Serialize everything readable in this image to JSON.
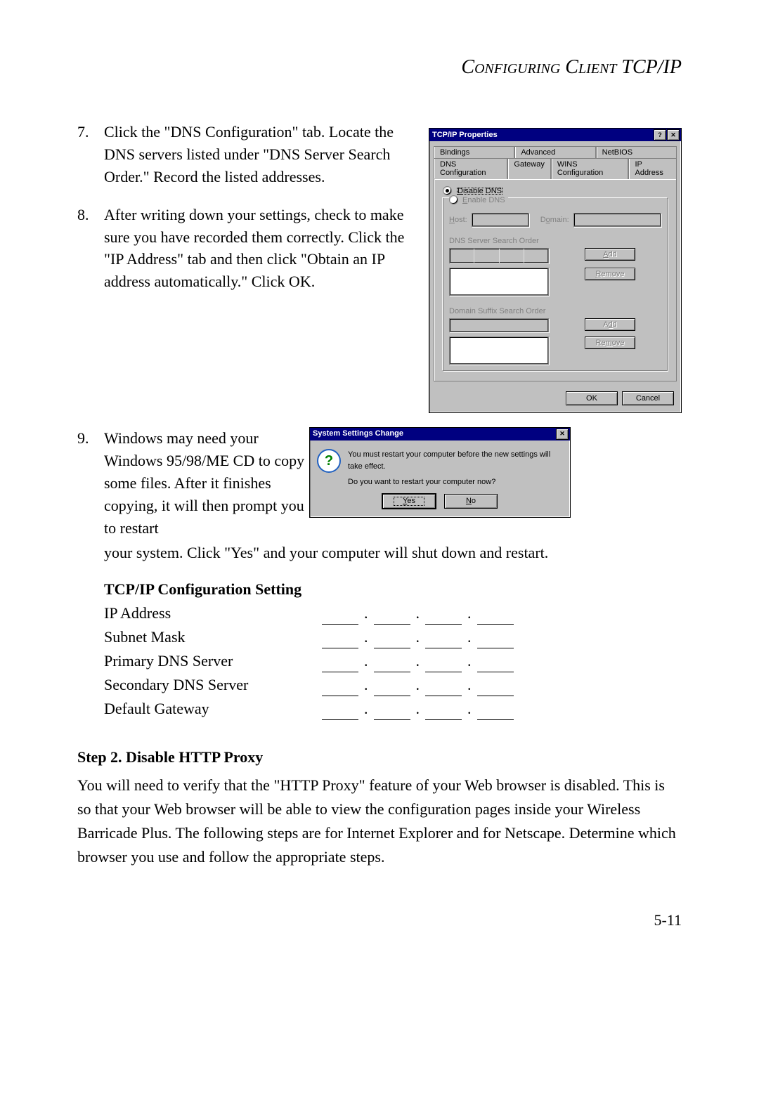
{
  "header": "Configuring Client TCP/IP",
  "steps": {
    "7": {
      "num": "7.",
      "text": "Click the \"DNS Configuration\" tab. Locate the DNS servers listed under \"DNS Server Search Order.\" Record the listed addresses."
    },
    "8": {
      "num": "8.",
      "text": "After writing down your settings, check to make sure you have recorded them correctly. Click the \"IP Address\" tab and then click \"Obtain an IP address automatically.\" Click OK."
    },
    "9": {
      "num": "9.",
      "text1": "Windows may need your Windows 95/98/ME CD to copy some files. After it finishes copying, it will then prompt you to restart",
      "text2": "your system. Click \"Yes\" and your computer will shut down and restart."
    }
  },
  "dialog1": {
    "title": "TCP/IP Properties",
    "tabs_row1": [
      "Bindings",
      "Advanced",
      "NetBIOS"
    ],
    "tabs_row2": [
      "DNS Configuration",
      "Gateway",
      "WINS Configuration",
      "IP Address"
    ],
    "radio_disable": "Disable DNS",
    "radio_enable": "Enable DNS",
    "host_label": "Host:",
    "domain_label": "Domain:",
    "dns_order_label": "DNS Server Search Order",
    "suffix_order_label": "Domain Suffix Search Order",
    "btn_add": "Add",
    "btn_remove": "Remove",
    "btn_ok": "OK",
    "btn_cancel": "Cancel"
  },
  "dialog2": {
    "title": "System Settings Change",
    "line1": "You must restart your computer before the new settings will take effect.",
    "line2": "Do you want to restart your computer now?",
    "btn_yes": "Yes",
    "btn_no": "No"
  },
  "config_table": {
    "heading": "TCP/IP Configuration Setting",
    "rows": [
      "IP Address",
      "Subnet Mask",
      "Primary DNS Server",
      "Secondary DNS Server",
      "Default Gateway"
    ]
  },
  "step2": {
    "heading": "Step 2. Disable HTTP Proxy",
    "body": "You will need to verify that the \"HTTP Proxy\" feature of your Web browser is disabled. This is so that your Web browser will be able to view the configuration pages inside your Wireless Barricade Plus. The following steps are for Internet Explorer and for Netscape. Determine which browser you use and follow the appropriate steps."
  },
  "page_number": "5-11"
}
